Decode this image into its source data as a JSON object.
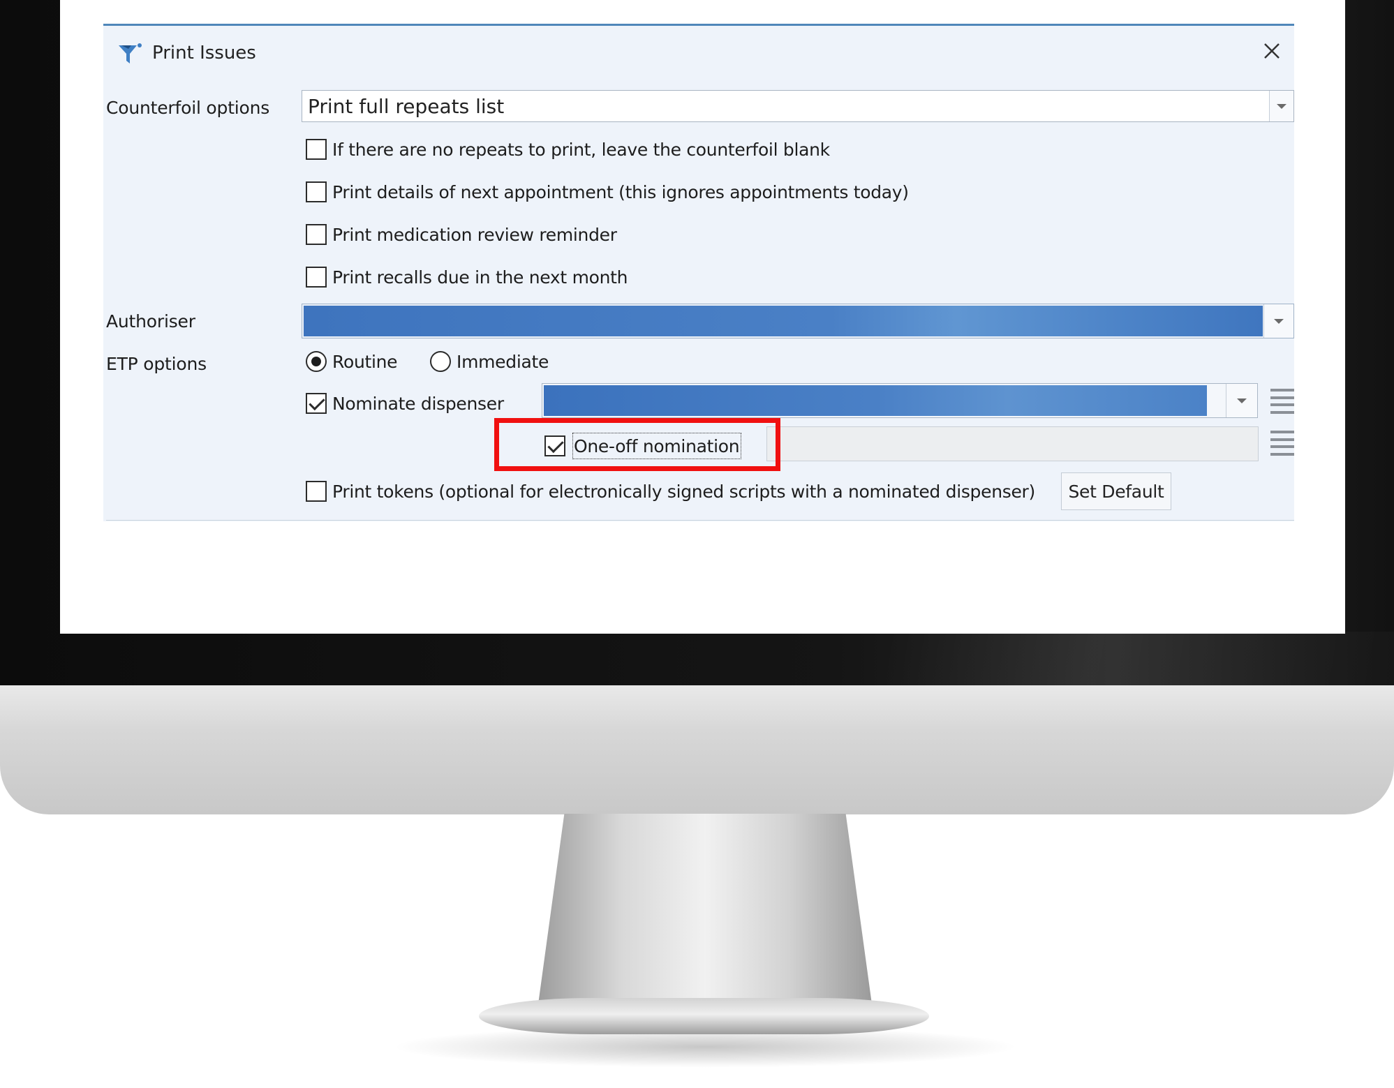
{
  "dialog": {
    "title": "Print Issues",
    "close_glyph": "✕"
  },
  "labels": {
    "counterfoil": "Counterfoil options",
    "authoriser": "Authoriser",
    "etp": "ETP options"
  },
  "counterfoil": {
    "selected": "Print full repeats list",
    "options": [
      {
        "label": "If there are no repeats to print, leave the counterfoil blank",
        "checked": false
      },
      {
        "label": "Print details of next appointment (this ignores appointments today)",
        "checked": false
      },
      {
        "label": "Print medication review reminder",
        "checked": false
      },
      {
        "label": "Print recalls due in the next month",
        "checked": false
      }
    ]
  },
  "etp": {
    "routine_label": "Routine",
    "routine_selected": true,
    "immediate_label": "Immediate",
    "immediate_selected": false,
    "nominate_label": "Nominate dispenser",
    "nominate_checked": true,
    "oneoff_label": "One-off nomination",
    "oneoff_checked": true
  },
  "tokens": {
    "label": "Print tokens (optional for electronically signed scripts with a nominated dispenser)",
    "checked": false
  },
  "buttons": {
    "set_default": "Set Default"
  },
  "colors": {
    "highlight": "#f01010",
    "selection_blue": "#4a80c6",
    "dialog_bg": "#eef3fa"
  },
  "icons": {
    "title": "filter-funnel-icon",
    "close": "close-icon",
    "dispenser_lookup": "list-icon",
    "oneoff_lookup": "list-icon"
  }
}
